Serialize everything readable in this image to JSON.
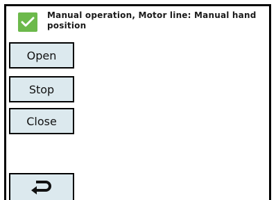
{
  "status": {
    "icon": "checkmark-icon",
    "icon_color": "#6cb94b",
    "text": "Manual operation, Motor line: Manual hand position"
  },
  "buttons": {
    "open_label": "Open",
    "stop_label": "Stop",
    "close_label": "Close",
    "back_icon": "return-arrow-icon"
  },
  "colors": {
    "button_bg": "#dce9ee",
    "frame": "#000000"
  }
}
